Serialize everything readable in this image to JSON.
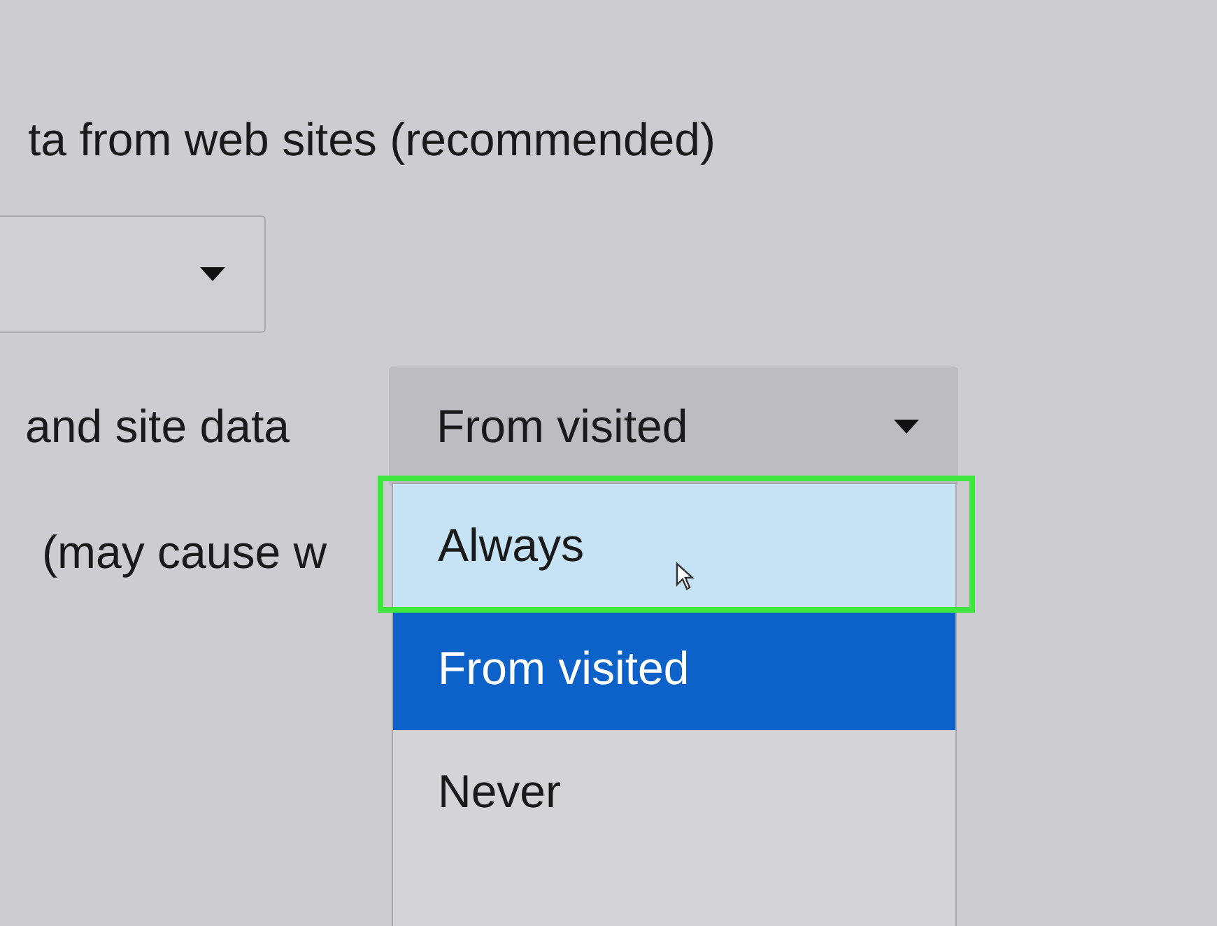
{
  "intro_text": "ta from web sites (recommended)",
  "cookies_label": "and site data",
  "cookies_dropdown": {
    "value": "From visited",
    "expanded": true
  },
  "warning_text": "(may cause w",
  "options": [
    {
      "label": "Always",
      "hovered": true,
      "selected": false
    },
    {
      "label": "From visited",
      "hovered": false,
      "selected": true
    },
    {
      "label": "Never",
      "hovered": false,
      "selected": false
    }
  ]
}
